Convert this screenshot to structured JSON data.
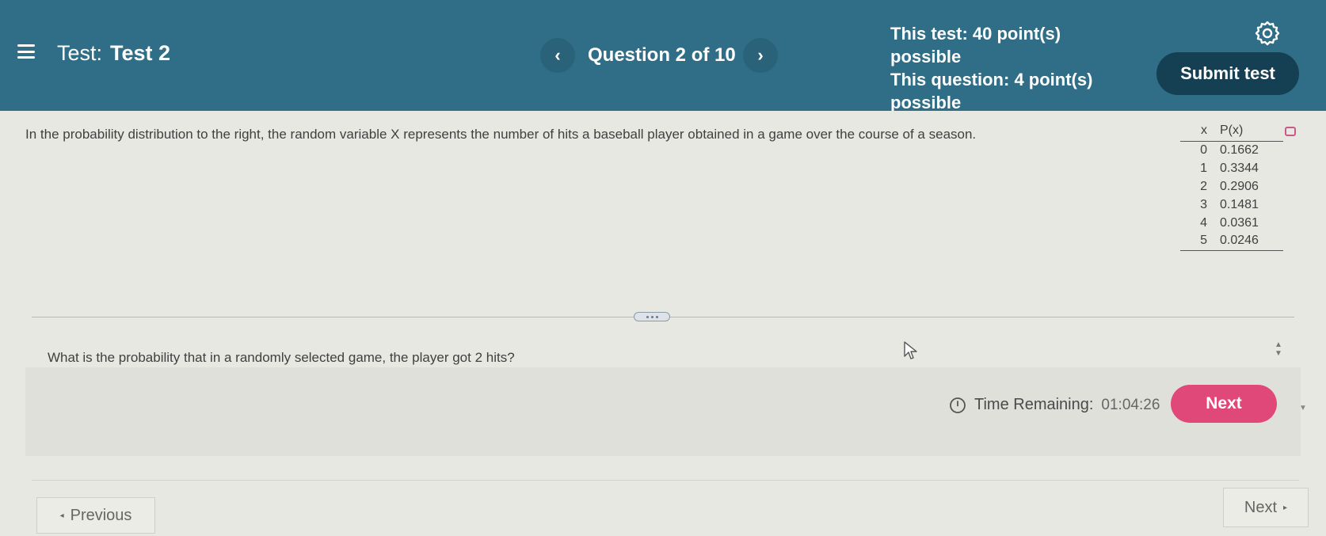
{
  "header": {
    "test_prefix": "Test:",
    "test_name": "Test 2",
    "question_counter": "Question 2 of 10",
    "prev_symbol": "‹",
    "next_symbol": "›",
    "points_line1": "This test: 40 point(s) possible",
    "points_line2": "This question: 4 point(s) possible",
    "submit_label": "Submit test",
    "icons": {
      "menu": "hamburger-menu-icon",
      "settings": "gear-icon"
    }
  },
  "problem": {
    "prompt": "In the probability distribution to the right, the random variable X represents the number of hits a baseball player obtained in a game over the course of a season.",
    "table": {
      "headers": [
        "x",
        "P(x)"
      ],
      "rows": [
        [
          "0",
          "0.1662"
        ],
        [
          "1",
          "0.3344"
        ],
        [
          "2",
          "0.2906"
        ],
        [
          "3",
          "0.1481"
        ],
        [
          "4",
          "0.0361"
        ],
        [
          "5",
          "0.0246"
        ]
      ]
    },
    "question": "What is the probability that in a randomly selected game, the player got 2 hits?"
  },
  "footer": {
    "time_label": "Time Remaining:",
    "time_value": "01:04:26",
    "next_label": "Next",
    "previous_bottom": "Previous",
    "next_bottom": "Next"
  },
  "colors": {
    "header_bg": "#2f6e86",
    "submit_bg": "#153f52",
    "next_bg": "#e0487a",
    "page_bg": "#e8e8e2"
  }
}
